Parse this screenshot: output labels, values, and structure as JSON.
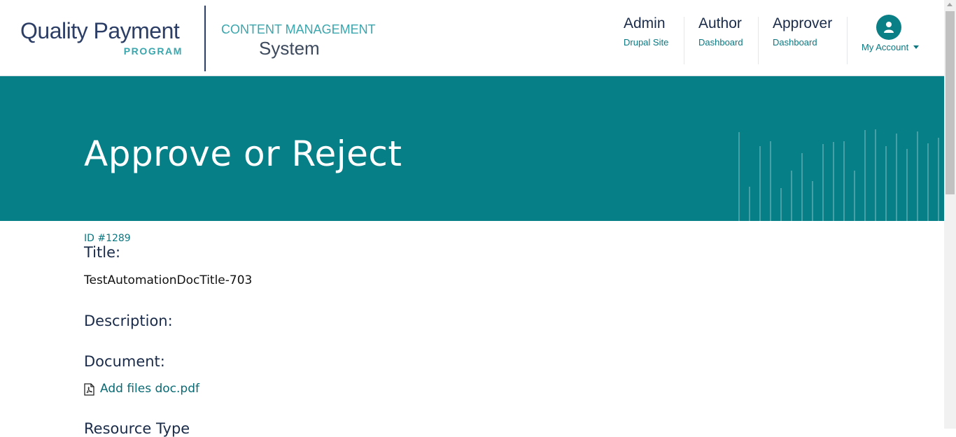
{
  "header": {
    "logo_line1": "Quality Payment",
    "logo_line2": "PROGRAM",
    "cms_line1": "CONTENT MANAGEMENT",
    "cms_line2": "System"
  },
  "nav": [
    {
      "title": "Admin",
      "subtitle": "Drupal Site"
    },
    {
      "title": "Author",
      "subtitle": "Dashboard"
    },
    {
      "title": "Approver",
      "subtitle": "Dashboard"
    }
  ],
  "account": {
    "label": "My Account",
    "icon": "user-icon"
  },
  "banner": {
    "title": "Approve or Reject",
    "color": "#067f86"
  },
  "content": {
    "id_label": "ID #1289",
    "title_label": "Title:",
    "title_value": "TestAutomationDocTitle-703",
    "description_label": "Description:",
    "document_label": "Document:",
    "document_file": "Add files doc.pdf",
    "document_icon": "pdf-file-icon",
    "resource_type_label": "Resource Type"
  }
}
